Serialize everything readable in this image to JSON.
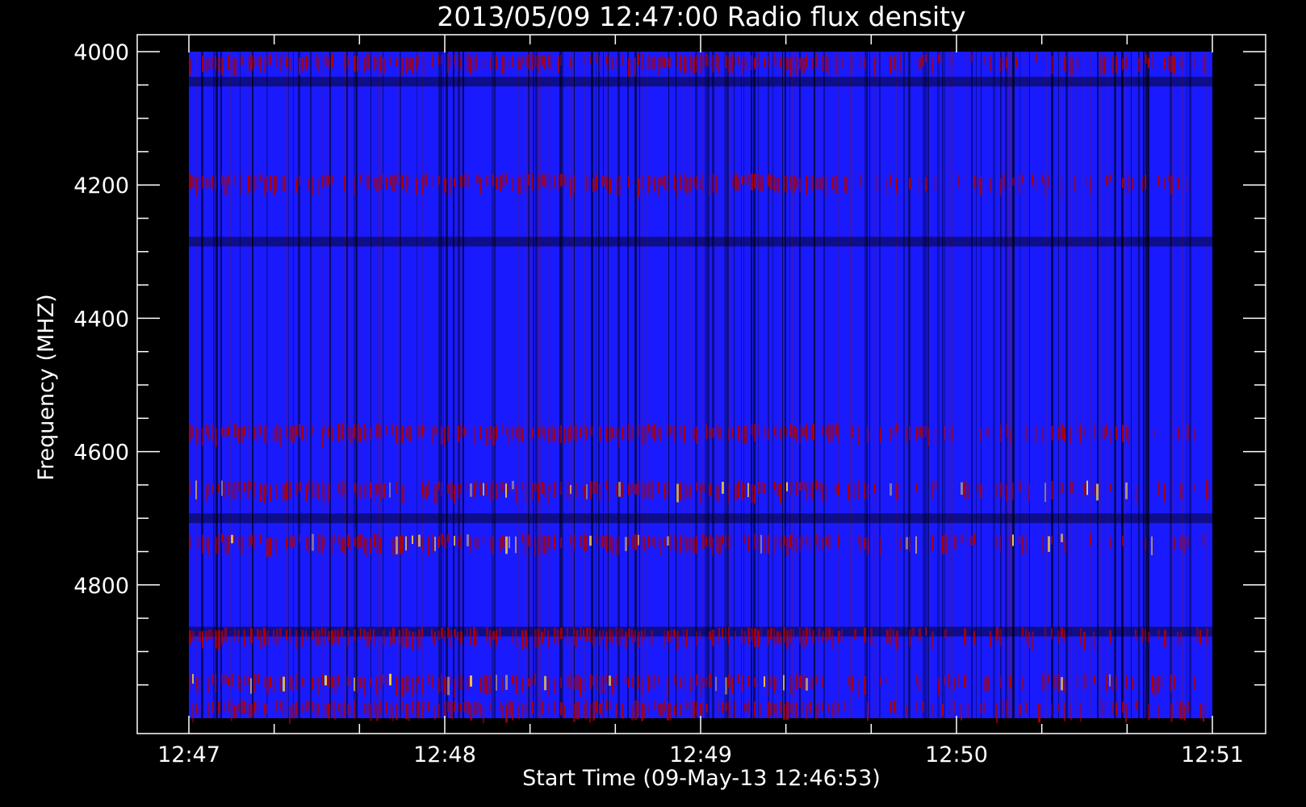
{
  "chart_data": {
    "type": "heatmap",
    "title": "2013/05/09 12:47:00 Radio flux density",
    "xlabel": "Start Time (09-May-13 12:46:53)",
    "ylabel": "Frequency (MHZ)",
    "x_ticks": [
      "12:47",
      "12:48",
      "12:49",
      "12:50",
      "12:51"
    ],
    "y_ticks": [
      "4000",
      "4200",
      "4400",
      "4600",
      "4800"
    ],
    "xlim_minutes": [
      0,
      4
    ],
    "ylim_mhz": [
      4000,
      5000
    ],
    "y_axis_inverted": true,
    "colors": {
      "background": "#000000",
      "axes": "#ffffff",
      "low": "#000000",
      "mid": "#1a1aff",
      "high": "#b00000",
      "peak": "#ffcc33"
    },
    "bright_bands_mhz": [
      4020,
      4200,
      4575,
      4660,
      4740,
      4880,
      4950,
      4990
    ],
    "dark_bands_mhz": [
      4045,
      4285,
      4700,
      4870
    ]
  }
}
